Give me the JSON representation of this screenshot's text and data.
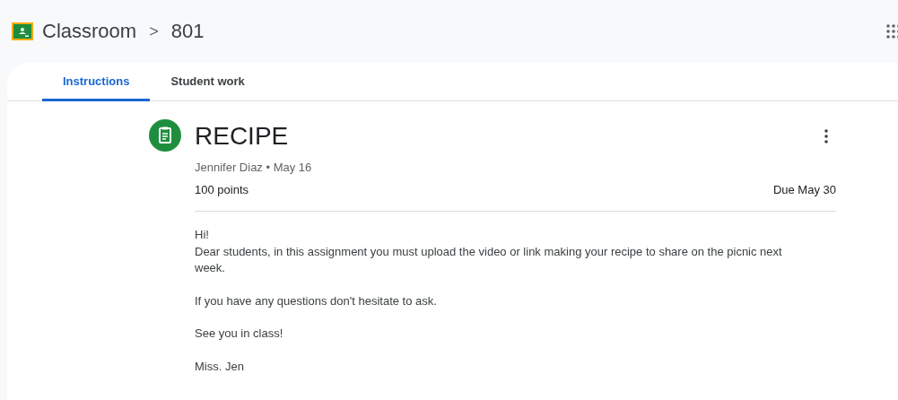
{
  "header": {
    "app_name": "Classroom",
    "separator": ">",
    "class_name": "801"
  },
  "tabs": [
    {
      "label": "Instructions",
      "selected": true
    },
    {
      "label": "Student work",
      "selected": false
    }
  ],
  "assignment": {
    "title": "RECIPE",
    "author_date": "Jennifer Diaz • May 16",
    "points": "100 points",
    "due": "Due May 30",
    "paragraphs": [
      [
        "Hi!",
        "Dear students, in this assignment you must upload the video or link making your recipe to share on the picnic next week."
      ],
      [
        "If you have any questions don't hesitate to ask."
      ],
      [
        "See you in class!"
      ],
      [
        "Miss. Jen"
      ]
    ]
  }
}
